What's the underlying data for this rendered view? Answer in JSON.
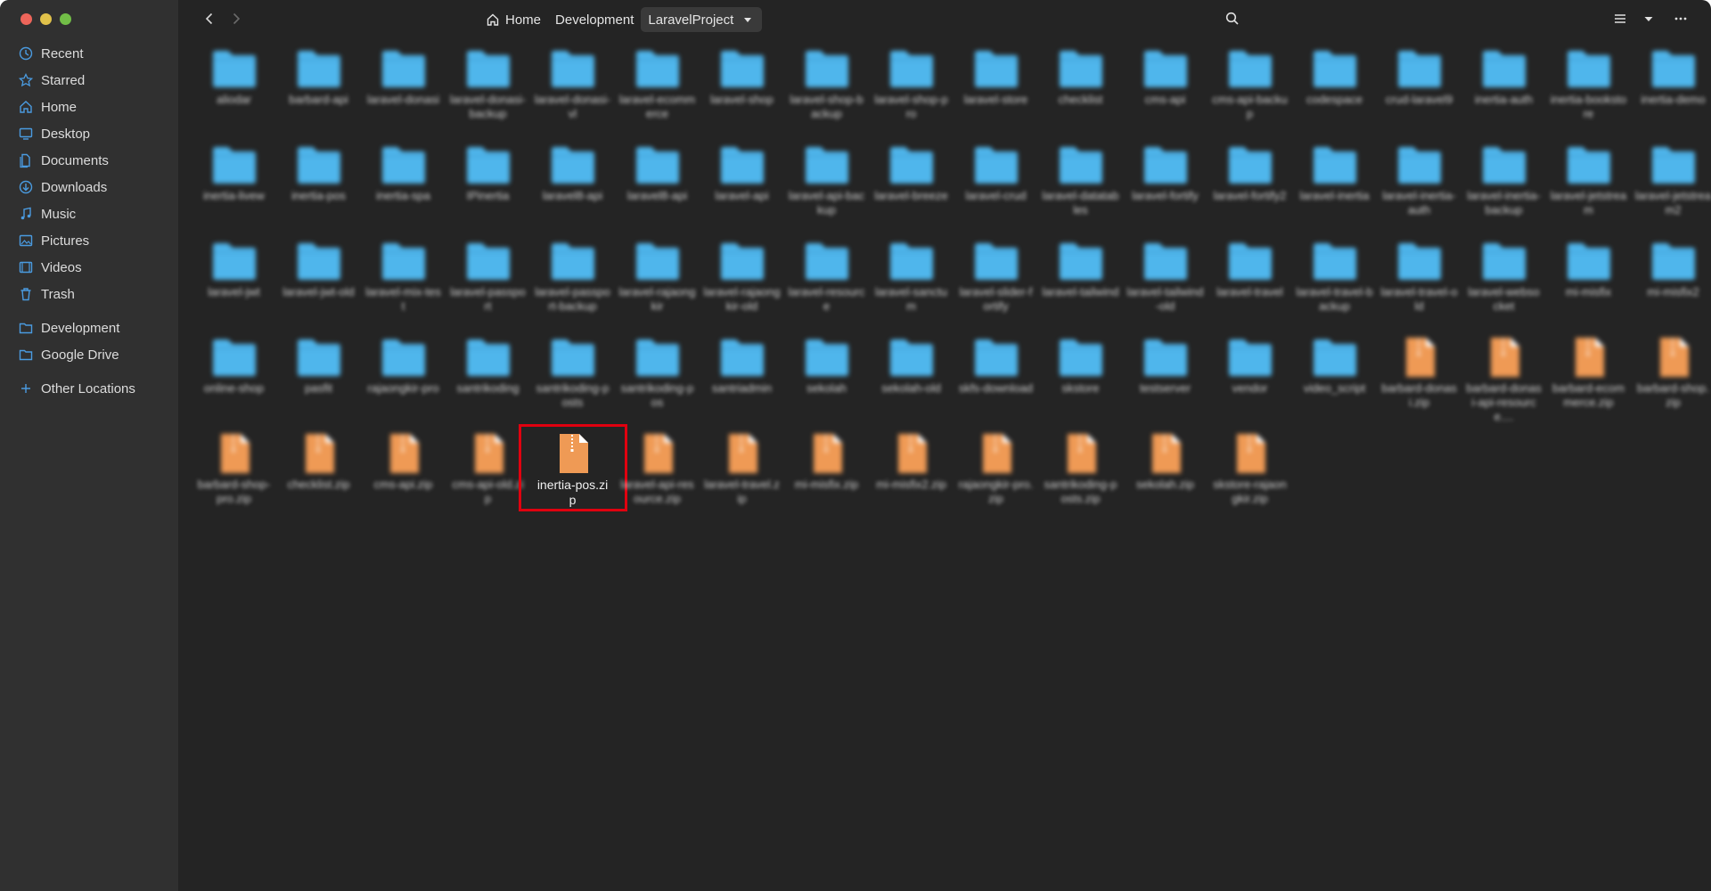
{
  "colors": {
    "window_bg": "#242424",
    "sidebar_bg": "#303030",
    "close": "#ed655a",
    "minimize": "#e0c14a",
    "maximize": "#72be47",
    "folder": "#4fb6ec",
    "archive": "#ef9a55",
    "selection": "#e0000f"
  },
  "sidebar": {
    "items": [
      {
        "label": "Recent",
        "icon": "clock-icon"
      },
      {
        "label": "Starred",
        "icon": "star-icon"
      },
      {
        "label": "Home",
        "icon": "home-icon"
      },
      {
        "label": "Desktop",
        "icon": "desktop-icon"
      },
      {
        "label": "Documents",
        "icon": "documents-icon"
      },
      {
        "label": "Downloads",
        "icon": "downloads-icon"
      },
      {
        "label": "Music",
        "icon": "music-icon"
      },
      {
        "label": "Pictures",
        "icon": "pictures-icon"
      },
      {
        "label": "Videos",
        "icon": "videos-icon"
      },
      {
        "label": "Trash",
        "icon": "trash-icon"
      }
    ],
    "bookmarks": [
      {
        "label": "Development",
        "icon": "folder-icon"
      },
      {
        "label": "Google Drive",
        "icon": "folder-icon"
      }
    ],
    "other_locations": {
      "label": "Other Locations",
      "icon": "plus-icon"
    }
  },
  "header": {
    "breadcrumbs": [
      {
        "label": "Home",
        "icon": "home-icon"
      },
      {
        "label": "Development"
      },
      {
        "label": "LaravelProject",
        "active": true
      }
    ]
  },
  "items": [
    {
      "type": "folder",
      "name": "aliodar"
    },
    {
      "type": "folder",
      "name": "barbard-api"
    },
    {
      "type": "folder",
      "name": "laravel-donasi"
    },
    {
      "type": "folder",
      "name": "laravel-donasi-backup"
    },
    {
      "type": "folder",
      "name": "laravel-donasi-vl"
    },
    {
      "type": "folder",
      "name": "laravel-ecommerce"
    },
    {
      "type": "folder",
      "name": "laravel-shop"
    },
    {
      "type": "folder",
      "name": "laravel-shop-backup"
    },
    {
      "type": "folder",
      "name": "laravel-shop-pro"
    },
    {
      "type": "folder",
      "name": "laravel-store"
    },
    {
      "type": "folder",
      "name": "checklist"
    },
    {
      "type": "folder",
      "name": "cms-api"
    },
    {
      "type": "folder",
      "name": "cms-api-backup"
    },
    {
      "type": "folder",
      "name": "codespace"
    },
    {
      "type": "folder",
      "name": "crud-laravel9"
    },
    {
      "type": "folder",
      "name": "inertia-auth"
    },
    {
      "type": "folder",
      "name": "inertia-bookstore"
    },
    {
      "type": "folder",
      "name": "inertia-demo"
    },
    {
      "type": "folder",
      "name": "inertia-livew"
    },
    {
      "type": "folder",
      "name": "inertia-pos"
    },
    {
      "type": "folder",
      "name": "inertia-spa"
    },
    {
      "type": "folder",
      "name": "IPinertia"
    },
    {
      "type": "folder",
      "name": "laravel8-api"
    },
    {
      "type": "folder",
      "name": "laravel8-api"
    },
    {
      "type": "folder",
      "name": "laravel-api"
    },
    {
      "type": "folder",
      "name": "laravel-api-backup"
    },
    {
      "type": "folder",
      "name": "laravel-breeze"
    },
    {
      "type": "folder",
      "name": "laravel-crud"
    },
    {
      "type": "folder",
      "name": "laravel-datatables"
    },
    {
      "type": "folder",
      "name": "laravel-fortify"
    },
    {
      "type": "folder",
      "name": "laravel-fortify2"
    },
    {
      "type": "folder",
      "name": "laravel-inertia"
    },
    {
      "type": "folder",
      "name": "laravel-inertia-auth"
    },
    {
      "type": "folder",
      "name": "laravel-inertia-backup"
    },
    {
      "type": "folder",
      "name": "laravel-jetstream"
    },
    {
      "type": "folder",
      "name": "laravel-jetstream2"
    },
    {
      "type": "folder",
      "name": "laravel-jwt"
    },
    {
      "type": "folder",
      "name": "laravel-jwt-old"
    },
    {
      "type": "folder",
      "name": "laravel-mix-test"
    },
    {
      "type": "folder",
      "name": "laravel-passport"
    },
    {
      "type": "folder",
      "name": "laravel-passport-backup"
    },
    {
      "type": "folder",
      "name": "laravel-rajaongkir"
    },
    {
      "type": "folder",
      "name": "laravel-rajaongkir-old"
    },
    {
      "type": "folder",
      "name": "laravel-resource"
    },
    {
      "type": "folder",
      "name": "laravel-sanctum"
    },
    {
      "type": "folder",
      "name": "laravel-slider-fortify"
    },
    {
      "type": "folder",
      "name": "laravel-tailwind"
    },
    {
      "type": "folder",
      "name": "laravel-tailwind-old"
    },
    {
      "type": "folder",
      "name": "laravel-travel"
    },
    {
      "type": "folder",
      "name": "laravel-travel-backup"
    },
    {
      "type": "folder",
      "name": "laravel-travel-old"
    },
    {
      "type": "folder",
      "name": "laravel-websocket"
    },
    {
      "type": "folder",
      "name": "mi-misfix"
    },
    {
      "type": "folder",
      "name": "mi-misfix2"
    },
    {
      "type": "folder",
      "name": "online-shop"
    },
    {
      "type": "folder",
      "name": "pasfit"
    },
    {
      "type": "folder",
      "name": "rajaongkir-pro"
    },
    {
      "type": "folder",
      "name": "santrikoding"
    },
    {
      "type": "folder",
      "name": "santrikoding-posts"
    },
    {
      "type": "folder",
      "name": "santrikoding-pos"
    },
    {
      "type": "folder",
      "name": "santriadmin"
    },
    {
      "type": "folder",
      "name": "sekolah"
    },
    {
      "type": "folder",
      "name": "sekolah-old"
    },
    {
      "type": "folder",
      "name": "skfs-download"
    },
    {
      "type": "folder",
      "name": "skstore"
    },
    {
      "type": "folder",
      "name": "testserver"
    },
    {
      "type": "folder",
      "name": "vendor"
    },
    {
      "type": "folder",
      "name": "video_script"
    },
    {
      "type": "archive",
      "name": "barbard-donasi.zip"
    },
    {
      "type": "archive",
      "name": "barbard-donasi-api-resource...."
    },
    {
      "type": "archive",
      "name": "barbard-ecommerce.zip"
    },
    {
      "type": "archive",
      "name": "barbard-shop.zip"
    },
    {
      "type": "archive",
      "name": "barbard-shop-pro.zip"
    },
    {
      "type": "archive",
      "name": "checklist.zip"
    },
    {
      "type": "archive",
      "name": "cms-api.zip"
    },
    {
      "type": "archive",
      "name": "cms-api-old.zip"
    },
    {
      "type": "archive",
      "name": "inertia-pos.zip",
      "selected": true
    },
    {
      "type": "archive",
      "name": "laravel-api-resource.zip"
    },
    {
      "type": "archive",
      "name": "laravel-travel.zip"
    },
    {
      "type": "archive",
      "name": "mi-misfix.zip"
    },
    {
      "type": "archive",
      "name": "mi-misfix2.zip"
    },
    {
      "type": "archive",
      "name": "rajaongkir-pro.zip"
    },
    {
      "type": "archive",
      "name": "santrikoding-posts.zip"
    },
    {
      "type": "archive",
      "name": "sekolah.zip"
    },
    {
      "type": "archive",
      "name": "skstore-rajaongkir.zip"
    }
  ]
}
